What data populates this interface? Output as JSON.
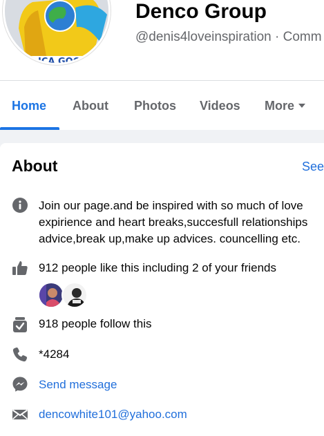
{
  "page": {
    "name": "Denco Group",
    "handle": "@denis4loveinspiration · Comm"
  },
  "tabs": [
    {
      "label": "Home",
      "active": true
    },
    {
      "label": "About",
      "active": false
    },
    {
      "label": "Photos",
      "active": false
    },
    {
      "label": "Videos",
      "active": false
    },
    {
      "label": "More",
      "active": false
    }
  ],
  "about": {
    "title": "About",
    "see_all": "See",
    "description": "Join our page.and be inspired with so much of love expirience and heart breaks,succesfull relationships advice,break up,make up advices. councelling etc.",
    "likes": "912 people like this including 2 of your friends",
    "follows": "918 people follow this",
    "phone": "*4284",
    "message": "Send message",
    "email": "dencowhite101@yahoo.com"
  },
  "icons": {
    "description": "info-icon",
    "likes": "thumbs-up-icon",
    "follows": "follow-icon",
    "phone": "phone-icon",
    "message": "messenger-icon",
    "email": "envelope-icon"
  },
  "colors": {
    "accent": "#1b74e4",
    "link": "#216fdb",
    "icon": "#65676b"
  }
}
